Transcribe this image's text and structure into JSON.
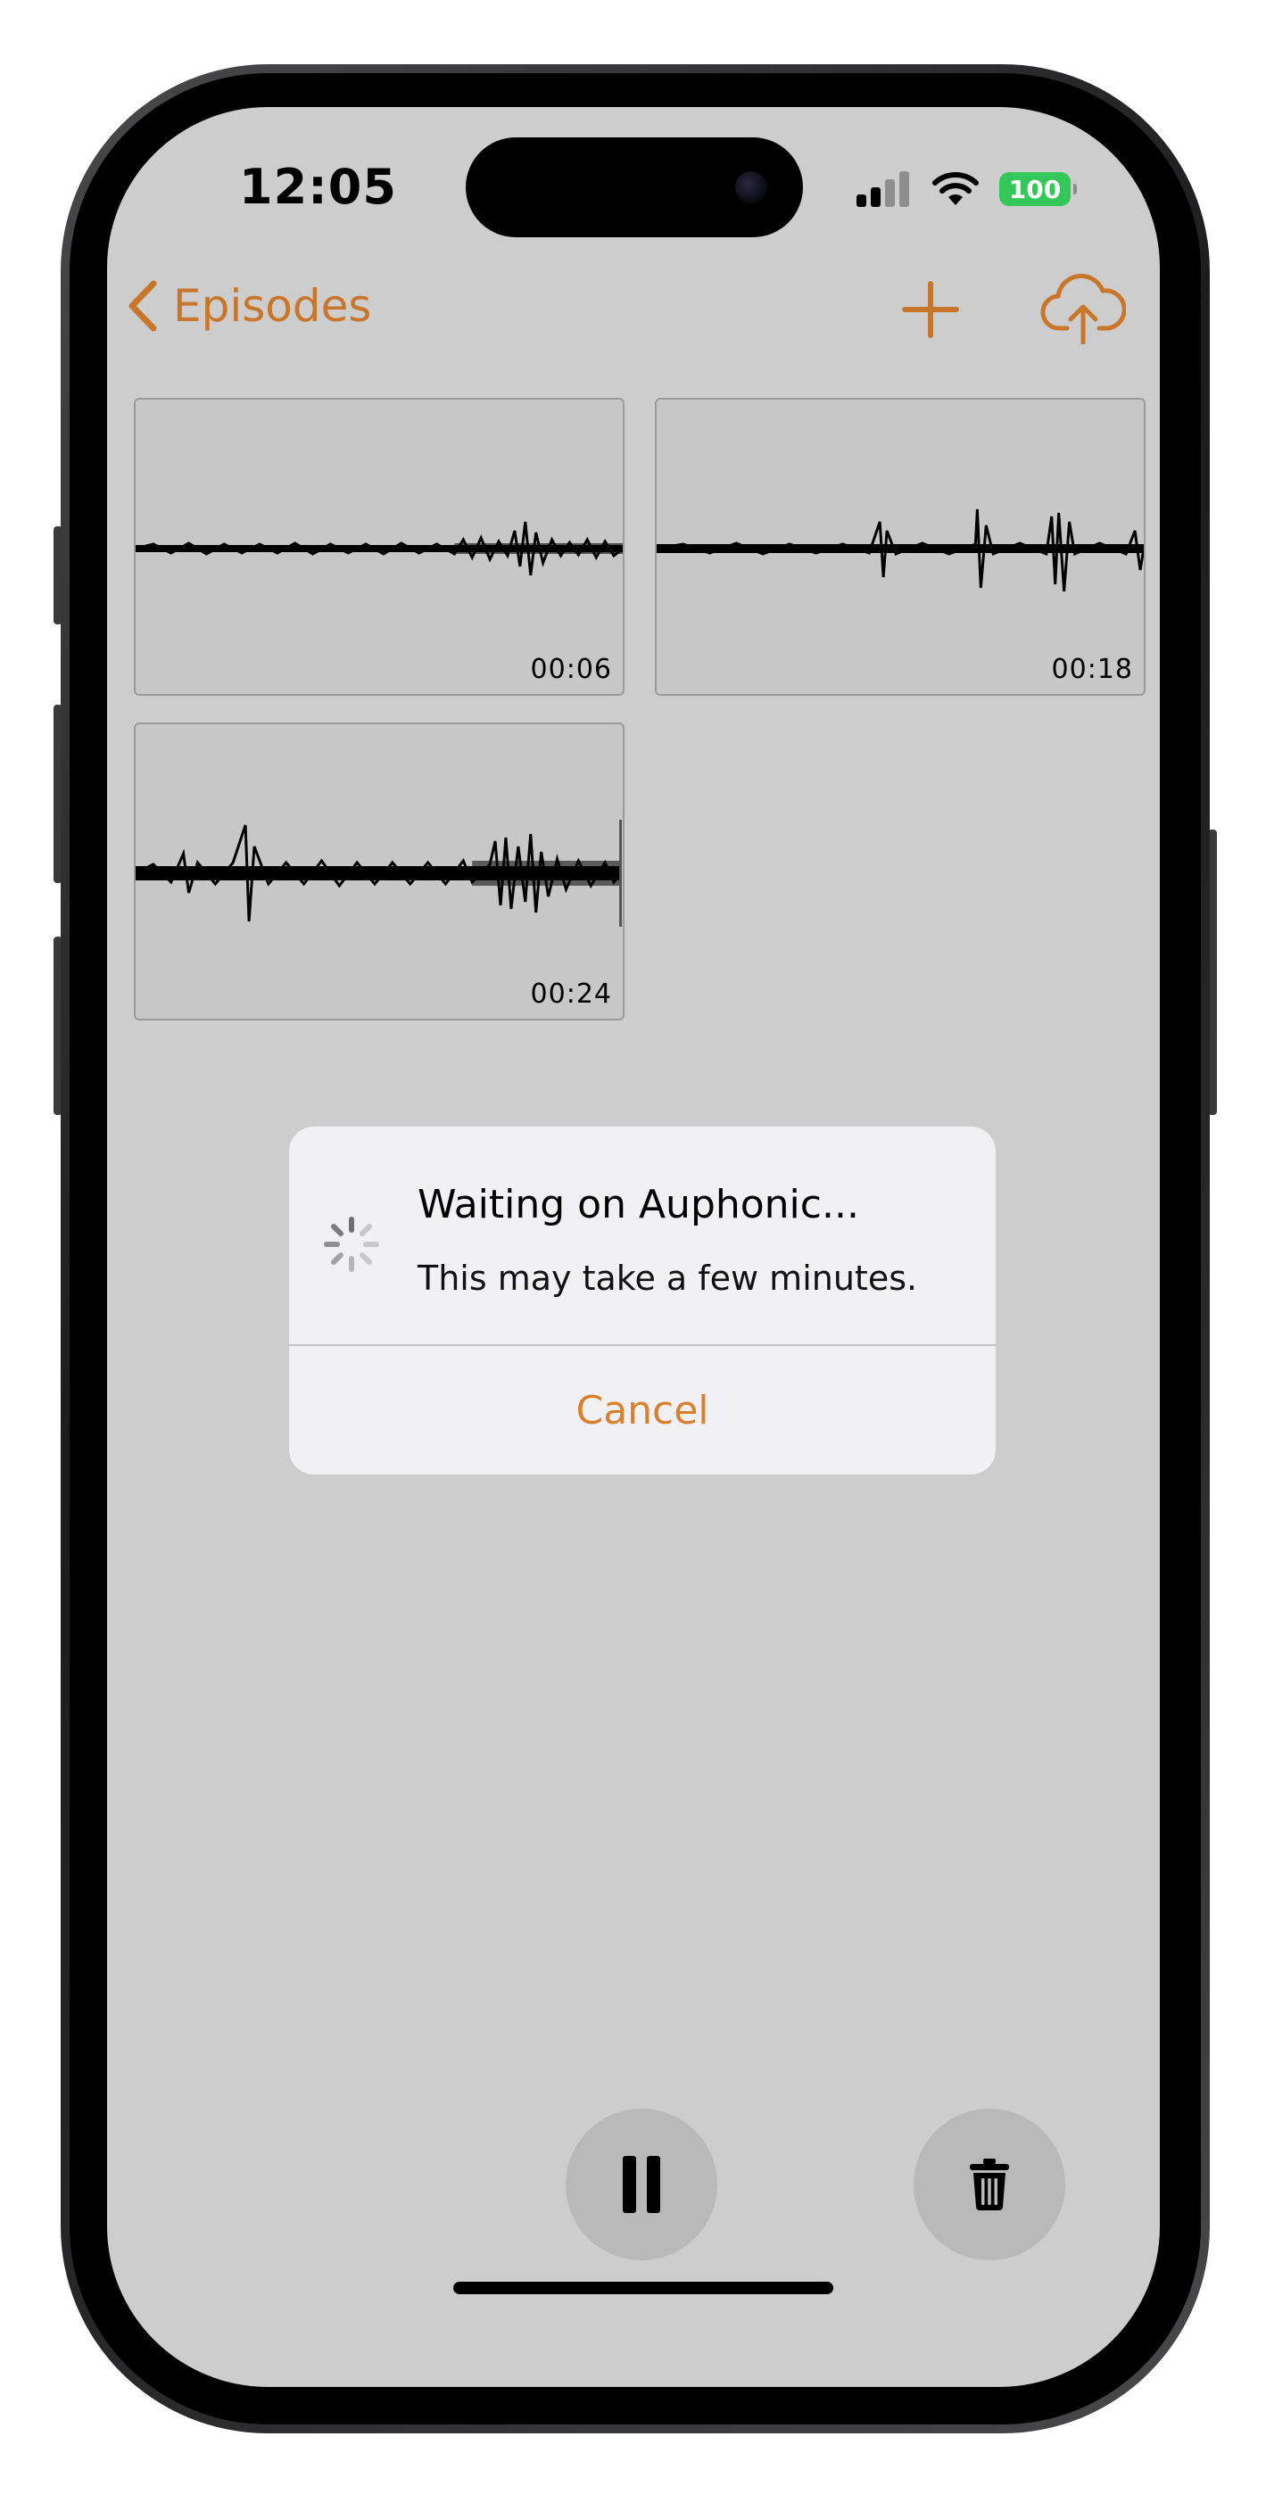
{
  "status_bar": {
    "time": "12:05",
    "battery_level": "100",
    "icons": [
      "cellular-signal-icon",
      "wifi-icon",
      "battery-icon"
    ]
  },
  "nav": {
    "back_label": "Episodes",
    "back_icon": "chevron-left-icon",
    "add_icon": "plus-icon",
    "upload_icon": "cloud-upload-icon"
  },
  "episodes": [
    {
      "duration": "00:06"
    },
    {
      "duration": "00:18"
    },
    {
      "duration": "00:24"
    }
  ],
  "alert": {
    "title": "Waiting on Auphonic...",
    "message": "This may take a few minutes.",
    "cancel_label": "Cancel",
    "spinner_icon": "activity-spinner-icon"
  },
  "controls": {
    "pause_icon": "pause-icon",
    "delete_icon": "trash-icon"
  },
  "colors": {
    "accent": "#c8762a",
    "alert_button": "#d9802f",
    "screen_background": "#cdcdcd",
    "battery": "#34c759"
  }
}
